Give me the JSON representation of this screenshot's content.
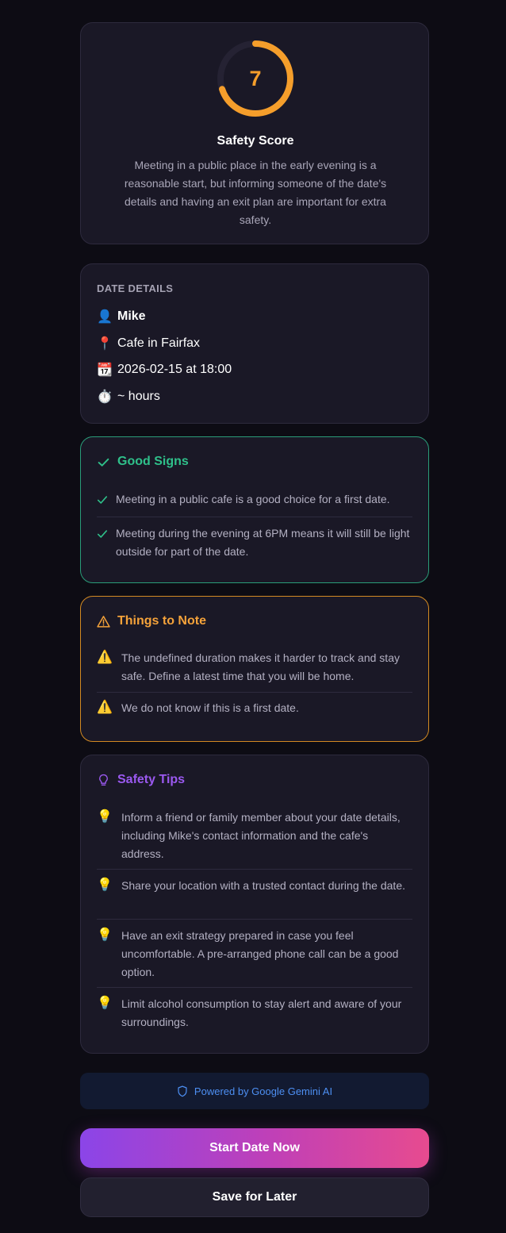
{
  "score": {
    "value": "7",
    "fraction": 0.7,
    "title": "Safety Score",
    "description": "Meeting in a public place in the early evening is a reasonable start, but informing someone of the date's details and having an exit plan are important for extra safety.",
    "color": "#f59e2b"
  },
  "details": {
    "heading": "DATE DETAILS",
    "name": {
      "icon": "👤",
      "text": "Mike"
    },
    "location": {
      "icon": "📍",
      "text": "Cafe in Fairfax"
    },
    "datetime": {
      "icon": "📆",
      "text": "2026-02-15 at 18:00"
    },
    "duration": {
      "icon": "⏱️",
      "text": "~ hours"
    }
  },
  "good_signs": {
    "title": "Good Signs",
    "color": "#2fc08a",
    "items": [
      "Meeting in a public cafe is a good choice for a first date.",
      "Meeting during the evening at 6PM means it will still be light outside for part of the date."
    ]
  },
  "notes": {
    "title": "Things to Note",
    "color": "#f4a23a",
    "marker": "⚠️",
    "items": [
      "The undefined duration makes it harder to track and stay safe. Define a latest time that you will be home.",
      "We do not know if this is a first date."
    ]
  },
  "tips": {
    "title": "Safety Tips",
    "color": "#9b59f0",
    "marker": "💡",
    "items": [
      "Inform a friend or family member about your date details, including Mike's contact information and the cafe's address.",
      "Share your location with a trusted contact during the date.",
      "Have an exit strategy prepared in case you feel uncomfortable. A pre-arranged phone call can be a good option.",
      "Limit alcohol consumption to stay alert and aware of your surroundings."
    ]
  },
  "powered_by": "Powered by Google Gemini AI",
  "buttons": {
    "start": "Start Date Now",
    "save": "Save for Later"
  }
}
